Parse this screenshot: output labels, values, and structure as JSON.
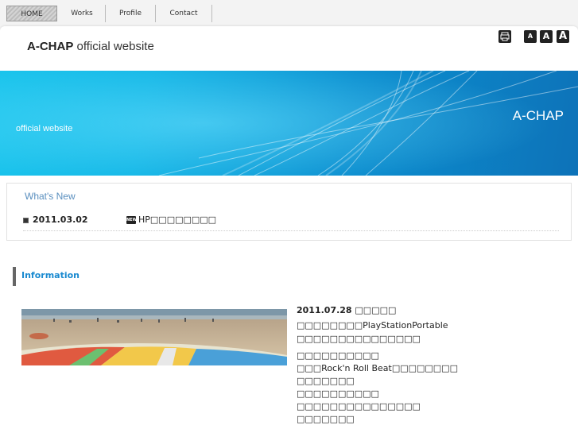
{
  "nav": {
    "items": [
      {
        "label": "HOME"
      },
      {
        "label": "Works"
      },
      {
        "label": "Profile"
      },
      {
        "label": "Contact"
      }
    ]
  },
  "header": {
    "title_bold": "A-CHAP",
    "title_rest": " official website",
    "tools": [
      {
        "icon": "print-icon"
      },
      {
        "label": "A",
        "size": "small"
      },
      {
        "label": "A",
        "size": "medium"
      },
      {
        "label": "A",
        "size": "large"
      }
    ]
  },
  "banner": {
    "subtitle": "official website",
    "brand": "A-CHAP"
  },
  "whats_new": {
    "heading": "What's New",
    "items": [
      {
        "date": "2011.03.02",
        "badge": "NEW",
        "text": "HP□□□□□□□□"
      }
    ]
  },
  "information": {
    "heading": "Information",
    "date_line": "2011.07.28 □□□□□",
    "lines": [
      "□□□□□□□□PlayStationPortable",
      "□□□□□□□□□□□□□□□",
      "□□□□□□□□□□",
      "□□□Rock'n Roll Beat□□□□□□□□",
      "□□□□□□□",
      "□□□□□□□□□□",
      "□□□□□□□□□□□□□□□",
      "□□□□□□□"
    ]
  },
  "colors": {
    "banner_start": "#1ac4ec",
    "banner_end": "#0d72b8",
    "heading_blue": "#1a8ad0"
  }
}
